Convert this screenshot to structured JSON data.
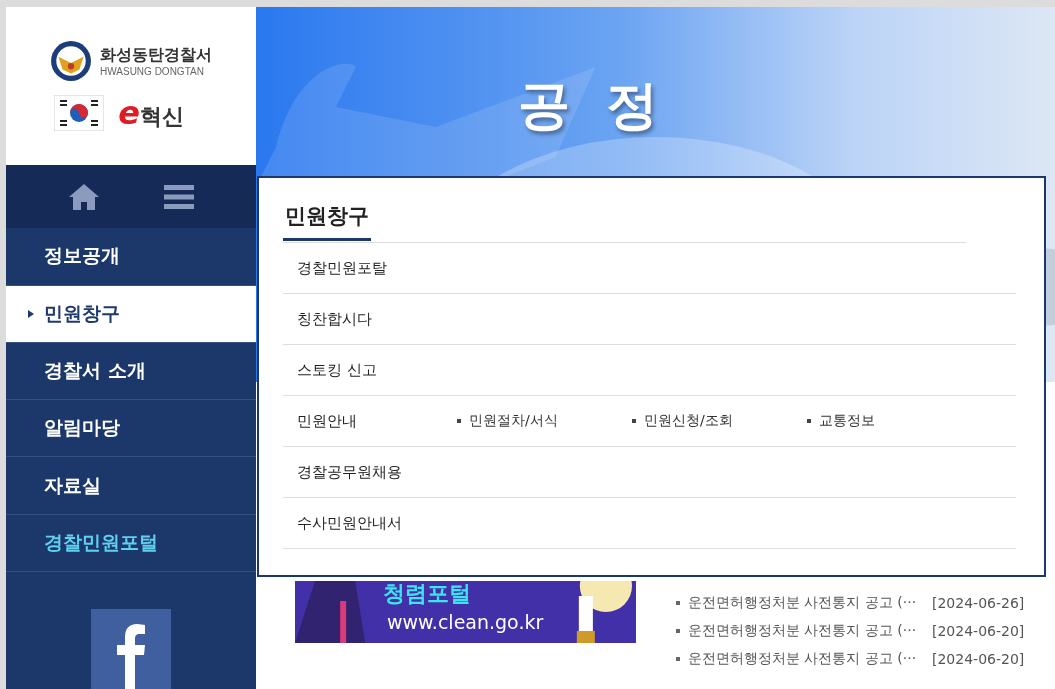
{
  "logo": {
    "name": "화성동탄경찰서",
    "subtitle": "HWASUNG DONGTAN",
    "innovation_letter": "e",
    "innovation_word": "혁신"
  },
  "sidebar": {
    "items": [
      {
        "label": "정보공개",
        "selected": false,
        "kind": "normal"
      },
      {
        "label": "민원창구",
        "selected": true,
        "kind": "normal"
      },
      {
        "label": "경찰서 소개",
        "selected": false,
        "kind": "normal"
      },
      {
        "label": "알림마당",
        "selected": false,
        "kind": "normal"
      },
      {
        "label": "자료실",
        "selected": false,
        "kind": "normal"
      },
      {
        "label": "경찰민원포털",
        "selected": false,
        "kind": "highlight"
      }
    ]
  },
  "hero": {
    "slogan": "공  정"
  },
  "dropdown": {
    "title": "민원창구",
    "rows": [
      {
        "label": "경찰민원포탈",
        "links": []
      },
      {
        "label": "칭찬합시다",
        "links": []
      },
      {
        "label": "스토킹 신고",
        "links": []
      },
      {
        "label": "민원안내",
        "links": [
          "민원절차/서식",
          "민원신청/조회",
          "교통정보"
        ]
      },
      {
        "label": "경찰공무원채용",
        "links": []
      },
      {
        "label": "수사민원안내서",
        "links": []
      }
    ]
  },
  "banner": {
    "title": "청렴포털",
    "url": "www.clean.go.kr"
  },
  "notices": [
    {
      "title": "운전면허행정처분 사전통지 공고 (···",
      "date": "[2024-06-26]"
    },
    {
      "title": "운전면허행정처분 사전통지 공고 (···",
      "date": "[2024-06-20]"
    },
    {
      "title": "운전면허행정처분 사전통지 공고 (···",
      "date": "[2024-06-20]"
    }
  ]
}
